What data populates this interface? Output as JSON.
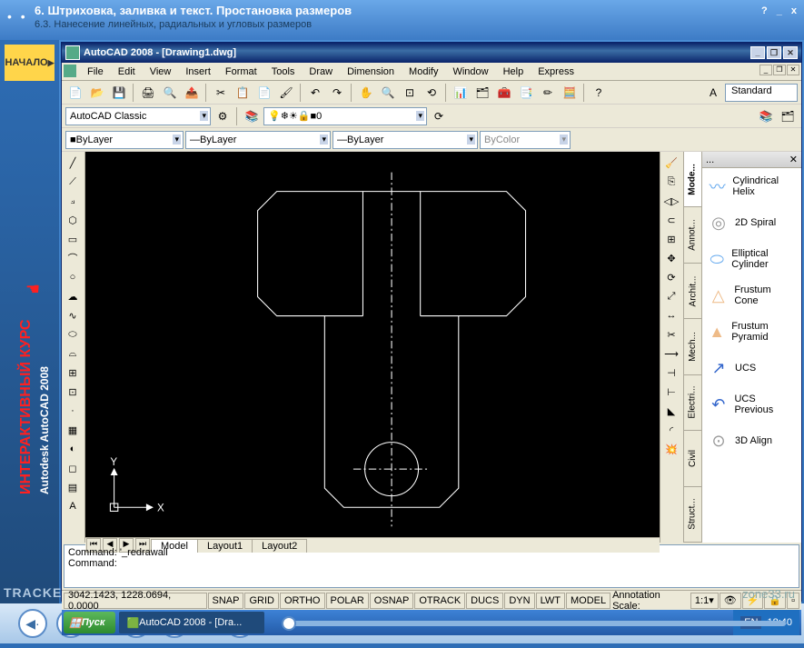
{
  "outer": {
    "title_main": "6. Штриховка, заливка и текст. Простановка размеров",
    "title_sub": "6.3. Нанесение линейных, радиальных и угловых размеров",
    "help": "?",
    "min": "_",
    "close": "x"
  },
  "sidebar": {
    "nachalo": "НАЧАЛО",
    "vert1": "ИНТЕРАКТИВНЫЙ КУРС",
    "vert2": "Autodesk AutoCAD 2008",
    "tracker": "TRACKER"
  },
  "acad": {
    "title": "AutoCAD 2008 - [Drawing1.dwg]"
  },
  "menu": [
    "File",
    "Edit",
    "View",
    "Insert",
    "Format",
    "Tools",
    "Draw",
    "Dimension",
    "Modify",
    "Window",
    "Help",
    "Express"
  ],
  "workspace": "AutoCAD Classic",
  "layer_value": "0",
  "props": {
    "color": "ByLayer",
    "linetype": "ByLayer",
    "lineweight": "ByLayer",
    "plotstyle": "ByColor"
  },
  "style_current": "Standard",
  "tabs": {
    "model": "Model",
    "l1": "Layout1",
    "l2": "Layout2"
  },
  "vtabs": [
    "Mode...",
    "Annot...",
    "Archit...",
    "Mech...",
    "Electri...",
    "Civil",
    "Struct..."
  ],
  "palette": {
    "header": "...",
    "items": [
      {
        "icon": "〰",
        "label": "Cylindrical Helix"
      },
      {
        "icon": "◎",
        "label": "2D Spiral"
      },
      {
        "icon": "🛢",
        "label": "Elliptical Cylinder"
      },
      {
        "icon": "△",
        "label": "Frustum Cone"
      },
      {
        "icon": "▲",
        "label": "Frustum Pyramid"
      },
      {
        "icon": "↗",
        "label": "UCS"
      },
      {
        "icon": "↶",
        "label": "UCS Previous"
      },
      {
        "icon": "⊙",
        "label": "3D Align"
      }
    ]
  },
  "command": {
    "line1": "Command: '_redrawall",
    "line2": "Command:"
  },
  "status": {
    "coords": "3042.1423, 1228.0694, 0.0000",
    "toggles": [
      "SNAP",
      "GRID",
      "ORTHO",
      "POLAR",
      "OSNAP",
      "OTRACK",
      "DUCS",
      "DYN",
      "LWT",
      "MODEL"
    ],
    "anno_label": "Annotation Scale:",
    "anno_value": "1:1"
  },
  "taskbar": {
    "start": "Пуск",
    "task": "AutoCAD 2008 - [Dra...",
    "lang": "EN",
    "time": "18:40"
  },
  "zone": "zone33.ru",
  "axis": {
    "x": "X",
    "y": "Y"
  }
}
